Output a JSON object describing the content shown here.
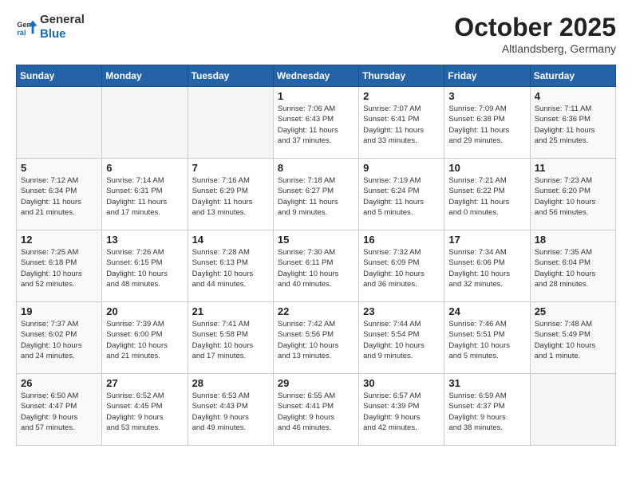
{
  "header": {
    "logo_line1": "General",
    "logo_line2": "Blue",
    "month": "October 2025",
    "location": "Altlandsberg, Germany"
  },
  "weekdays": [
    "Sunday",
    "Monday",
    "Tuesday",
    "Wednesday",
    "Thursday",
    "Friday",
    "Saturday"
  ],
  "weeks": [
    [
      {
        "day": "",
        "info": ""
      },
      {
        "day": "",
        "info": ""
      },
      {
        "day": "",
        "info": ""
      },
      {
        "day": "1",
        "info": "Sunrise: 7:06 AM\nSunset: 6:43 PM\nDaylight: 11 hours\nand 37 minutes."
      },
      {
        "day": "2",
        "info": "Sunrise: 7:07 AM\nSunset: 6:41 PM\nDaylight: 11 hours\nand 33 minutes."
      },
      {
        "day": "3",
        "info": "Sunrise: 7:09 AM\nSunset: 6:38 PM\nDaylight: 11 hours\nand 29 minutes."
      },
      {
        "day": "4",
        "info": "Sunrise: 7:11 AM\nSunset: 6:36 PM\nDaylight: 11 hours\nand 25 minutes."
      }
    ],
    [
      {
        "day": "5",
        "info": "Sunrise: 7:12 AM\nSunset: 6:34 PM\nDaylight: 11 hours\nand 21 minutes."
      },
      {
        "day": "6",
        "info": "Sunrise: 7:14 AM\nSunset: 6:31 PM\nDaylight: 11 hours\nand 17 minutes."
      },
      {
        "day": "7",
        "info": "Sunrise: 7:16 AM\nSunset: 6:29 PM\nDaylight: 11 hours\nand 13 minutes."
      },
      {
        "day": "8",
        "info": "Sunrise: 7:18 AM\nSunset: 6:27 PM\nDaylight: 11 hours\nand 9 minutes."
      },
      {
        "day": "9",
        "info": "Sunrise: 7:19 AM\nSunset: 6:24 PM\nDaylight: 11 hours\nand 5 minutes."
      },
      {
        "day": "10",
        "info": "Sunrise: 7:21 AM\nSunset: 6:22 PM\nDaylight: 11 hours\nand 0 minutes."
      },
      {
        "day": "11",
        "info": "Sunrise: 7:23 AM\nSunset: 6:20 PM\nDaylight: 10 hours\nand 56 minutes."
      }
    ],
    [
      {
        "day": "12",
        "info": "Sunrise: 7:25 AM\nSunset: 6:18 PM\nDaylight: 10 hours\nand 52 minutes."
      },
      {
        "day": "13",
        "info": "Sunrise: 7:26 AM\nSunset: 6:15 PM\nDaylight: 10 hours\nand 48 minutes."
      },
      {
        "day": "14",
        "info": "Sunrise: 7:28 AM\nSunset: 6:13 PM\nDaylight: 10 hours\nand 44 minutes."
      },
      {
        "day": "15",
        "info": "Sunrise: 7:30 AM\nSunset: 6:11 PM\nDaylight: 10 hours\nand 40 minutes."
      },
      {
        "day": "16",
        "info": "Sunrise: 7:32 AM\nSunset: 6:09 PM\nDaylight: 10 hours\nand 36 minutes."
      },
      {
        "day": "17",
        "info": "Sunrise: 7:34 AM\nSunset: 6:06 PM\nDaylight: 10 hours\nand 32 minutes."
      },
      {
        "day": "18",
        "info": "Sunrise: 7:35 AM\nSunset: 6:04 PM\nDaylight: 10 hours\nand 28 minutes."
      }
    ],
    [
      {
        "day": "19",
        "info": "Sunrise: 7:37 AM\nSunset: 6:02 PM\nDaylight: 10 hours\nand 24 minutes."
      },
      {
        "day": "20",
        "info": "Sunrise: 7:39 AM\nSunset: 6:00 PM\nDaylight: 10 hours\nand 21 minutes."
      },
      {
        "day": "21",
        "info": "Sunrise: 7:41 AM\nSunset: 5:58 PM\nDaylight: 10 hours\nand 17 minutes."
      },
      {
        "day": "22",
        "info": "Sunrise: 7:42 AM\nSunset: 5:56 PM\nDaylight: 10 hours\nand 13 minutes."
      },
      {
        "day": "23",
        "info": "Sunrise: 7:44 AM\nSunset: 5:54 PM\nDaylight: 10 hours\nand 9 minutes."
      },
      {
        "day": "24",
        "info": "Sunrise: 7:46 AM\nSunset: 5:51 PM\nDaylight: 10 hours\nand 5 minutes."
      },
      {
        "day": "25",
        "info": "Sunrise: 7:48 AM\nSunset: 5:49 PM\nDaylight: 10 hours\nand 1 minute."
      }
    ],
    [
      {
        "day": "26",
        "info": "Sunrise: 6:50 AM\nSunset: 4:47 PM\nDaylight: 9 hours\nand 57 minutes."
      },
      {
        "day": "27",
        "info": "Sunrise: 6:52 AM\nSunset: 4:45 PM\nDaylight: 9 hours\nand 53 minutes."
      },
      {
        "day": "28",
        "info": "Sunrise: 6:53 AM\nSunset: 4:43 PM\nDaylight: 9 hours\nand 49 minutes."
      },
      {
        "day": "29",
        "info": "Sunrise: 6:55 AM\nSunset: 4:41 PM\nDaylight: 9 hours\nand 46 minutes."
      },
      {
        "day": "30",
        "info": "Sunrise: 6:57 AM\nSunset: 4:39 PM\nDaylight: 9 hours\nand 42 minutes."
      },
      {
        "day": "31",
        "info": "Sunrise: 6:59 AM\nSunset: 4:37 PM\nDaylight: 9 hours\nand 38 minutes."
      },
      {
        "day": "",
        "info": ""
      }
    ]
  ]
}
